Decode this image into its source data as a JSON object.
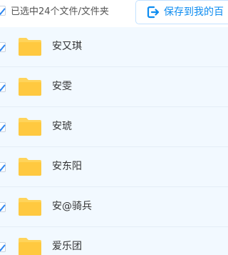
{
  "header": {
    "selected_text": "已选中24个文件/文件夹",
    "save_button_label": "保存到我的百"
  },
  "files": [
    {
      "name": "安又琪"
    },
    {
      "name": "安雯"
    },
    {
      "name": "安琥"
    },
    {
      "name": "安东阳"
    },
    {
      "name": "安@骑兵"
    },
    {
      "name": "爱乐团"
    }
  ],
  "colors": {
    "accent": "#0d8cf0",
    "folder": "#ffd45a",
    "list_bg": "#f2f9ff"
  }
}
